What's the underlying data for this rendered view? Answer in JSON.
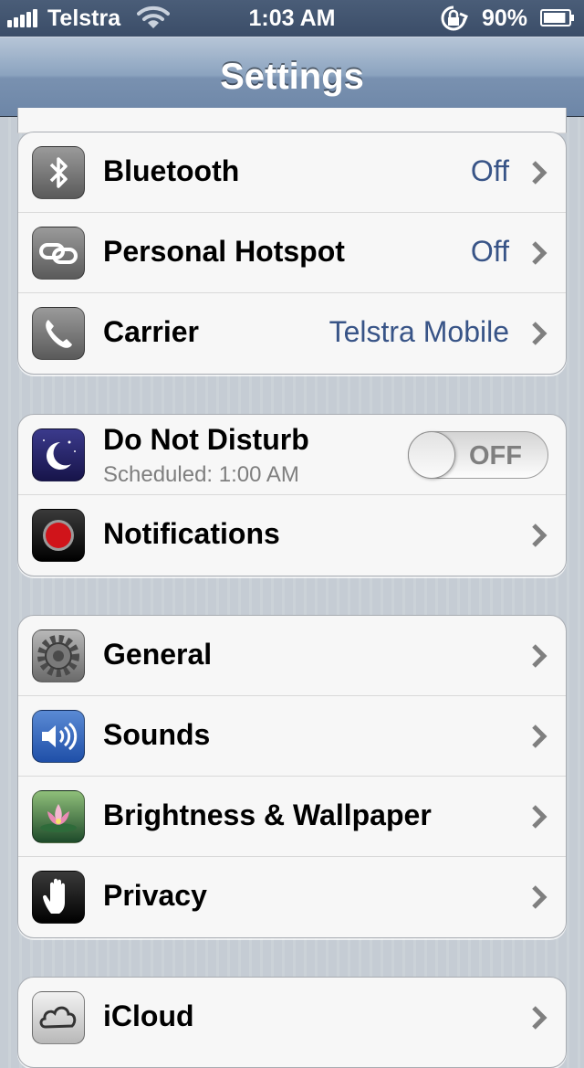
{
  "status_bar": {
    "carrier": "Telstra",
    "time": "1:03 AM",
    "battery_percent": "90%",
    "signal_bars": 5,
    "battery_level": 0.9
  },
  "nav": {
    "title": "Settings"
  },
  "groups": [
    {
      "rows": [
        {
          "label": "Bluetooth",
          "value": "Off",
          "icon": "bluetooth-icon"
        },
        {
          "label": "Personal Hotspot",
          "value": "Off",
          "icon": "hotspot-icon"
        },
        {
          "label": "Carrier",
          "value": "Telstra Mobile",
          "icon": "phone-icon"
        }
      ]
    },
    {
      "rows": [
        {
          "label": "Do Not Disturb",
          "sublabel": "Scheduled: 1:00 AM",
          "toggle": "OFF",
          "icon": "moon-icon"
        },
        {
          "label": "Notifications",
          "icon": "notifications-icon"
        }
      ]
    },
    {
      "rows": [
        {
          "label": "General",
          "icon": "gear-icon"
        },
        {
          "label": "Sounds",
          "icon": "speaker-icon"
        },
        {
          "label": "Brightness & Wallpaper",
          "icon": "flower-icon"
        },
        {
          "label": "Privacy",
          "icon": "hand-icon"
        }
      ]
    },
    {
      "rows": [
        {
          "label": "iCloud",
          "icon": "cloud-icon"
        }
      ]
    }
  ],
  "colors": {
    "value_text": "#385487",
    "nav_bar": "#8ba3bf",
    "status_bar": "#3b4d68"
  }
}
